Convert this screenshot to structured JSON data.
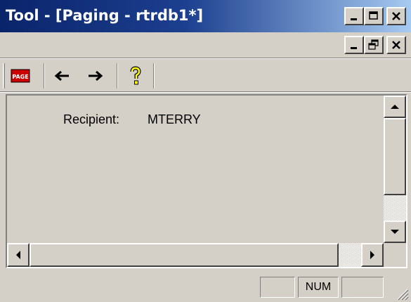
{
  "window": {
    "title": "Tool - [Paging - rtrdb1*]"
  },
  "toolbar": {
    "buttons": [
      {
        "name": "page",
        "label": "PAGE",
        "icon": "page-icon"
      },
      {
        "name": "back",
        "icon": "arrow-left-icon"
      },
      {
        "name": "forward",
        "icon": "arrow-right-icon"
      },
      {
        "name": "help",
        "icon": "help-icon"
      }
    ]
  },
  "content": {
    "recipient_label": "Recipient:",
    "recipient_value": "MTERRY"
  },
  "statusbar": {
    "panes": [
      "",
      "NUM",
      ""
    ]
  },
  "colors": {
    "titlebar_start": "#0a246a",
    "titlebar_end": "#a6caf0",
    "face": "#d4d0c8",
    "page_icon_red": "#cc0000",
    "help_icon_yellow": "#ffff00"
  }
}
